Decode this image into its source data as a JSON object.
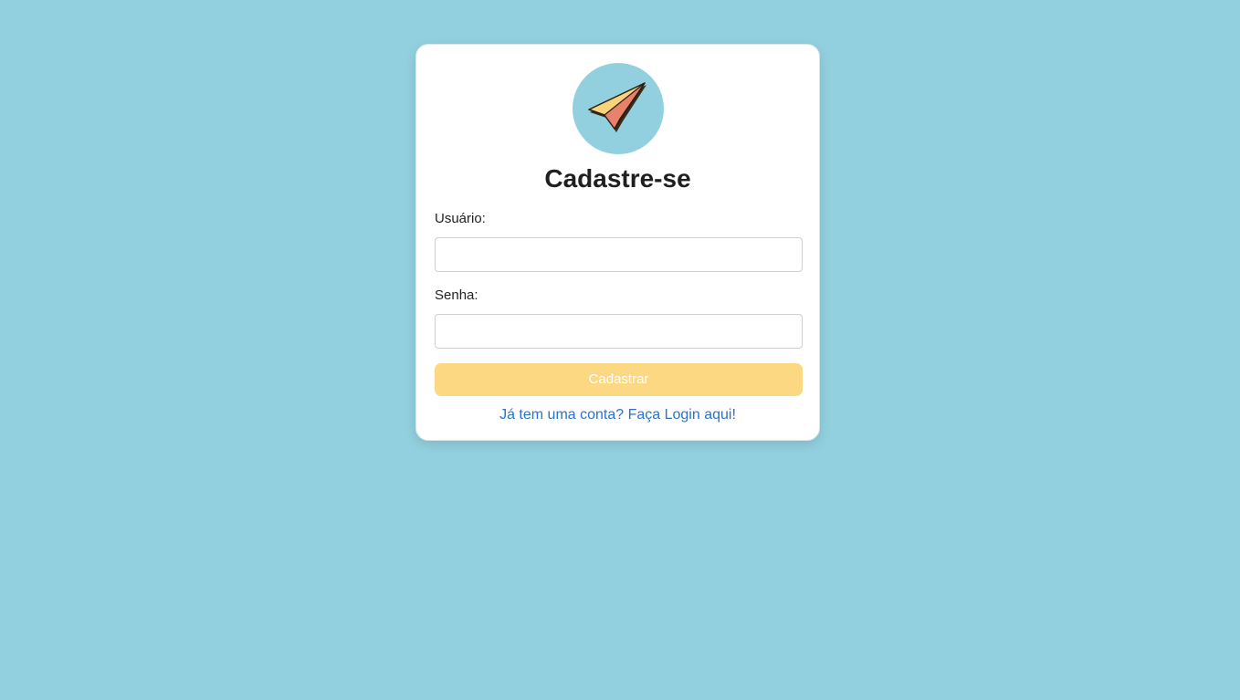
{
  "colors": {
    "background": "#93d0df",
    "card": "#ffffff",
    "button": "#fcd883",
    "link": "#2a73c7",
    "logo_circle": "#93d0df",
    "plane_yellow": "#f9d27a",
    "plane_red": "#e8826b"
  },
  "logo": {
    "icon": "paper-plane-icon"
  },
  "form": {
    "title": "Cadastre-se",
    "user_label": "Usuário:",
    "user_value": "",
    "password_label": "Senha:",
    "password_value": "",
    "submit_label": "Cadastrar",
    "login_link": "Já tem uma conta? Faça Login aqui!"
  }
}
